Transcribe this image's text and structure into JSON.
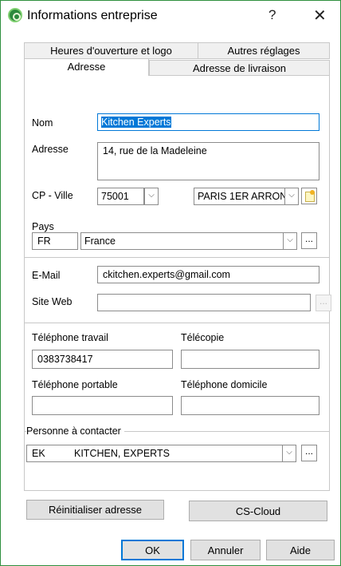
{
  "window": {
    "title": "Informations entreprise",
    "help_glyph": "?",
    "close_glyph": "✕",
    "app_icon": "app-logo-icon"
  },
  "tabs": {
    "row1": [
      "Heures d'ouverture et logo",
      "Autres réglages"
    ],
    "row2": [
      "Adresse",
      "Adresse de livraison"
    ],
    "active": "Adresse"
  },
  "form": {
    "nom_label": "Nom",
    "nom_value": "Kitchen Experts",
    "adresse_label": "Adresse",
    "adresse_value": "14, rue de la Madeleine",
    "cp_ville_label": "CP - Ville",
    "cp_value": "75001",
    "ville_value": "PARIS 1ER ARRON",
    "pays_label": "Pays",
    "pays_code": "FR",
    "pays_name": "France",
    "email_label": "E-Mail",
    "email_value": "ckitchen.experts@gmail.com",
    "site_label": "Site Web",
    "site_value": "",
    "tel_travail_label": "Téléphone travail",
    "tel_travail_value": "0383738417",
    "telecopie_label": "Télécopie",
    "telecopie_value": "",
    "tel_portable_label": "Téléphone portable",
    "tel_portable_value": "",
    "tel_domicile_label": "Téléphone domicile",
    "tel_domicile_value": "",
    "contact_label": "Personne à contacter",
    "contact_code": "EK",
    "contact_name": "KITCHEN, EXPERTS",
    "dots": "...",
    "dropdown_glyph": "⌵"
  },
  "actions": {
    "reset_label": "Réinitialiser adresse",
    "cloud_label": "CS-Cloud",
    "ok_label": "OK",
    "cancel_label": "Annuler",
    "help_label": "Aide"
  },
  "colors": {
    "window_border": "#2f8f3e",
    "selection": "#0078d7"
  }
}
